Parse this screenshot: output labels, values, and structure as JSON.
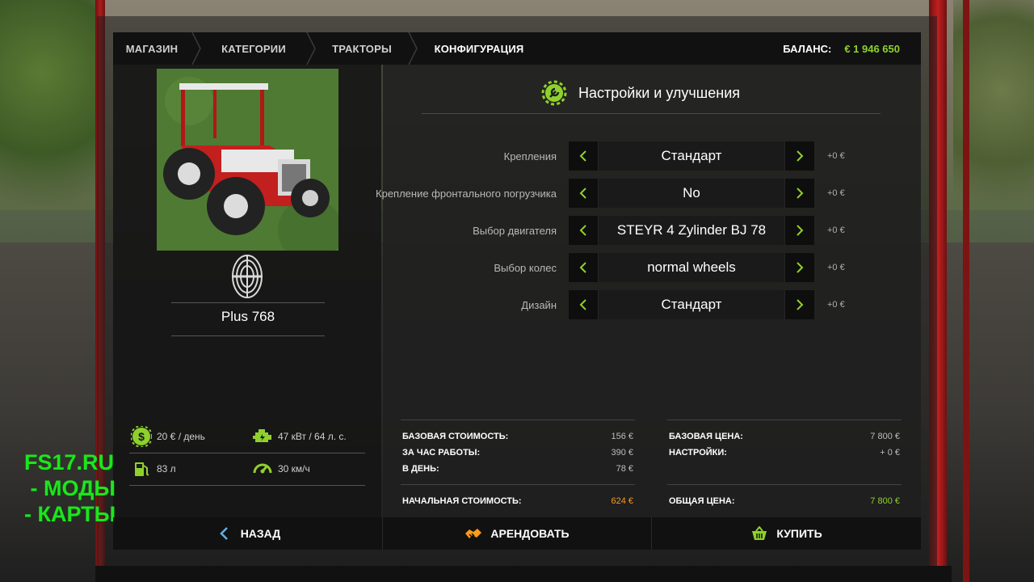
{
  "breadcrumb": {
    "items": [
      "МАГАЗИН",
      "КАТЕГОРИИ",
      "ТРАКТОРЫ",
      "КОНФИГУРАЦИЯ"
    ]
  },
  "balance": {
    "label": "БАЛАНС:",
    "value": "€ 1 946 650"
  },
  "vehicle": {
    "name": "Plus 768",
    "stats": {
      "daily_cost": "20 € / день",
      "power": "47 кВт / 64 л. с.",
      "fuel": "83 л",
      "speed": "30 км/ч"
    }
  },
  "watermark": {
    "lines": [
      "FS17.RU",
      " - МОДЫ",
      "- КАРТЫ"
    ]
  },
  "config": {
    "title": "Настройки и улучшения",
    "options": [
      {
        "label": "Крепления",
        "value": "Стандарт",
        "price": "+0 €"
      },
      {
        "label": "Крепление фронтального погрузчика",
        "value": "No",
        "price": "+0 €"
      },
      {
        "label": "Выбор двигателя",
        "value": "STEYR 4 Zylinder BJ 78",
        "price": "+0 €"
      },
      {
        "label": "Выбор колес",
        "value": "normal wheels",
        "price": "+0 €"
      },
      {
        "label": "Дизайн",
        "value": "Стандарт",
        "price": "+0 €"
      }
    ]
  },
  "costs": {
    "left": [
      {
        "label": "БАЗОВАЯ СТОИМОСТЬ:",
        "value": "156 €"
      },
      {
        "label": "ЗА ЧАС РАБОТЫ:",
        "value": "390 €"
      },
      {
        "label": "В ДЕНЬ:",
        "value": "78 €"
      }
    ],
    "left_total": {
      "label": "НАЧАЛЬНАЯ СТОИМОСТЬ:",
      "value": "624 €"
    },
    "right": [
      {
        "label": "БАЗОВАЯ ЦЕНА:",
        "value": "7 800 €"
      },
      {
        "label": "НАСТРОЙКИ:",
        "value": "+ 0 €"
      }
    ],
    "right_total": {
      "label": "ОБЩАЯ ЦЕНА:",
      "value": "7 800 €"
    }
  },
  "buttons": {
    "back": "НАЗАД",
    "lease": "АРЕНДОВАТЬ",
    "buy": "КУПИТЬ"
  },
  "colors": {
    "accent_green": "#8fd12c",
    "accent_orange": "#ff9a1a",
    "watermark_green": "#1fe41f"
  }
}
